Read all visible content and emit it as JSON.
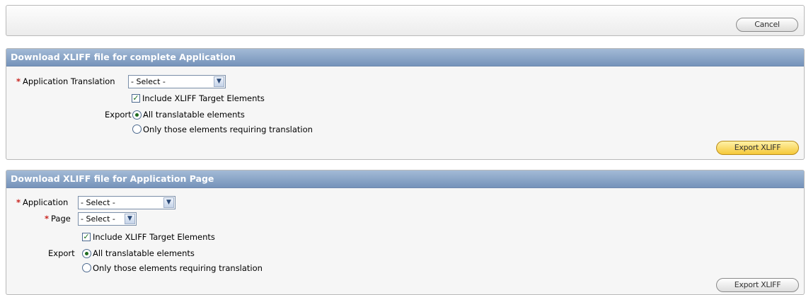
{
  "top": {
    "cancel_label": "Cancel"
  },
  "region1": {
    "title": "Download XLIFF file for complete Application",
    "app_translation_label": "Application Translation",
    "app_translation_value": "- Select -",
    "include_target_label": "Include XLIFF Target Elements",
    "include_target_checked": true,
    "export_label": "Export",
    "export_options": [
      "All translatable elements",
      "Only those elements requiring translation"
    ],
    "export_selected": 0,
    "export_button": "Export XLIFF"
  },
  "region2": {
    "title": "Download XLIFF file for Application Page",
    "application_label": "Application",
    "application_value": "- Select -",
    "page_label": "Page",
    "page_value": "- Select -",
    "include_target_label": "Include XLIFF Target Elements",
    "include_target_checked": true,
    "export_label": "Export",
    "export_options": [
      "All translatable elements",
      "Only those elements requiring translation"
    ],
    "export_selected": 0,
    "export_button": "Export XLIFF"
  },
  "colors": {
    "header_blue": "#7593ba",
    "required_red": "#c8221d",
    "export_button_gold": "#f5c838"
  }
}
